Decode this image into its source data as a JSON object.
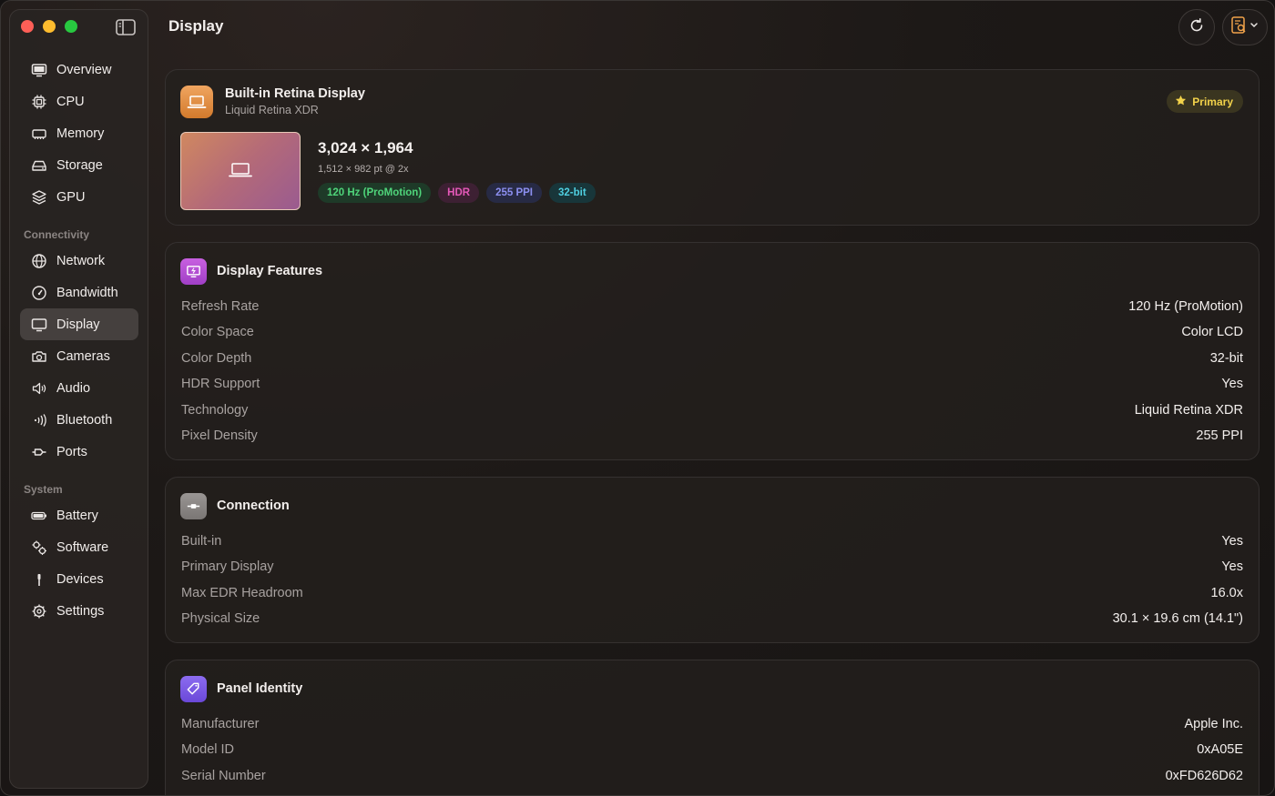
{
  "window": {
    "title": "Display"
  },
  "sidebar": {
    "groups": [
      {
        "label": "",
        "items": [
          {
            "label": "Overview",
            "icon": "monitor-icon"
          },
          {
            "label": "CPU",
            "icon": "cpu-icon"
          },
          {
            "label": "Memory",
            "icon": "memory-icon"
          },
          {
            "label": "Storage",
            "icon": "storage-icon"
          },
          {
            "label": "GPU",
            "icon": "gpu-icon"
          }
        ]
      },
      {
        "label": "Connectivity",
        "items": [
          {
            "label": "Network",
            "icon": "globe-icon"
          },
          {
            "label": "Bandwidth",
            "icon": "gauge-icon"
          },
          {
            "label": "Display",
            "icon": "display-icon",
            "active": true
          },
          {
            "label": "Cameras",
            "icon": "camera-icon"
          },
          {
            "label": "Audio",
            "icon": "speaker-icon"
          },
          {
            "label": "Bluetooth",
            "icon": "bluetooth-icon"
          },
          {
            "label": "Ports",
            "icon": "ports-icon"
          }
        ]
      },
      {
        "label": "System",
        "items": [
          {
            "label": "Battery",
            "icon": "battery-icon"
          },
          {
            "label": "Software",
            "icon": "gears-icon"
          },
          {
            "label": "Devices",
            "icon": "device-icon"
          },
          {
            "label": "Settings",
            "icon": "settings-icon"
          }
        ]
      }
    ]
  },
  "display": {
    "name": "Built-in Retina Display",
    "subtitle": "Liquid Retina XDR",
    "primary_badge": "Primary",
    "resolution": "3,024 × 1,964",
    "points": "1,512 × 982 pt @ 2x",
    "tags": [
      "120 Hz (ProMotion)",
      "HDR",
      "255 PPI",
      "32-bit"
    ]
  },
  "features": {
    "title": "Display Features",
    "rows": [
      {
        "key": "Refresh Rate",
        "value": "120 Hz (ProMotion)"
      },
      {
        "key": "Color Space",
        "value": "Color LCD"
      },
      {
        "key": "Color Depth",
        "value": "32-bit"
      },
      {
        "key": "HDR Support",
        "value": "Yes"
      },
      {
        "key": "Technology",
        "value": "Liquid Retina XDR"
      },
      {
        "key": "Pixel Density",
        "value": "255 PPI"
      }
    ]
  },
  "connection": {
    "title": "Connection",
    "rows": [
      {
        "key": "Built-in",
        "value": "Yes"
      },
      {
        "key": "Primary Display",
        "value": "Yes"
      },
      {
        "key": "Max EDR Headroom",
        "value": "16.0x"
      },
      {
        "key": "Physical Size",
        "value": "30.1 × 19.6 cm (14.1\")"
      }
    ]
  },
  "panel": {
    "title": "Panel Identity",
    "rows": [
      {
        "key": "Manufacturer",
        "value": "Apple Inc."
      },
      {
        "key": "Model ID",
        "value": "0xA05E"
      },
      {
        "key": "Serial Number",
        "value": "0xFD626D62"
      }
    ]
  },
  "colors": {
    "accent_orange": "#e08a3c",
    "features_icon": "#b94fd6",
    "connection_icon": "#8a8684",
    "panel_icon": "#7b5ce0",
    "primary_badge_text": "#f2d24a"
  }
}
